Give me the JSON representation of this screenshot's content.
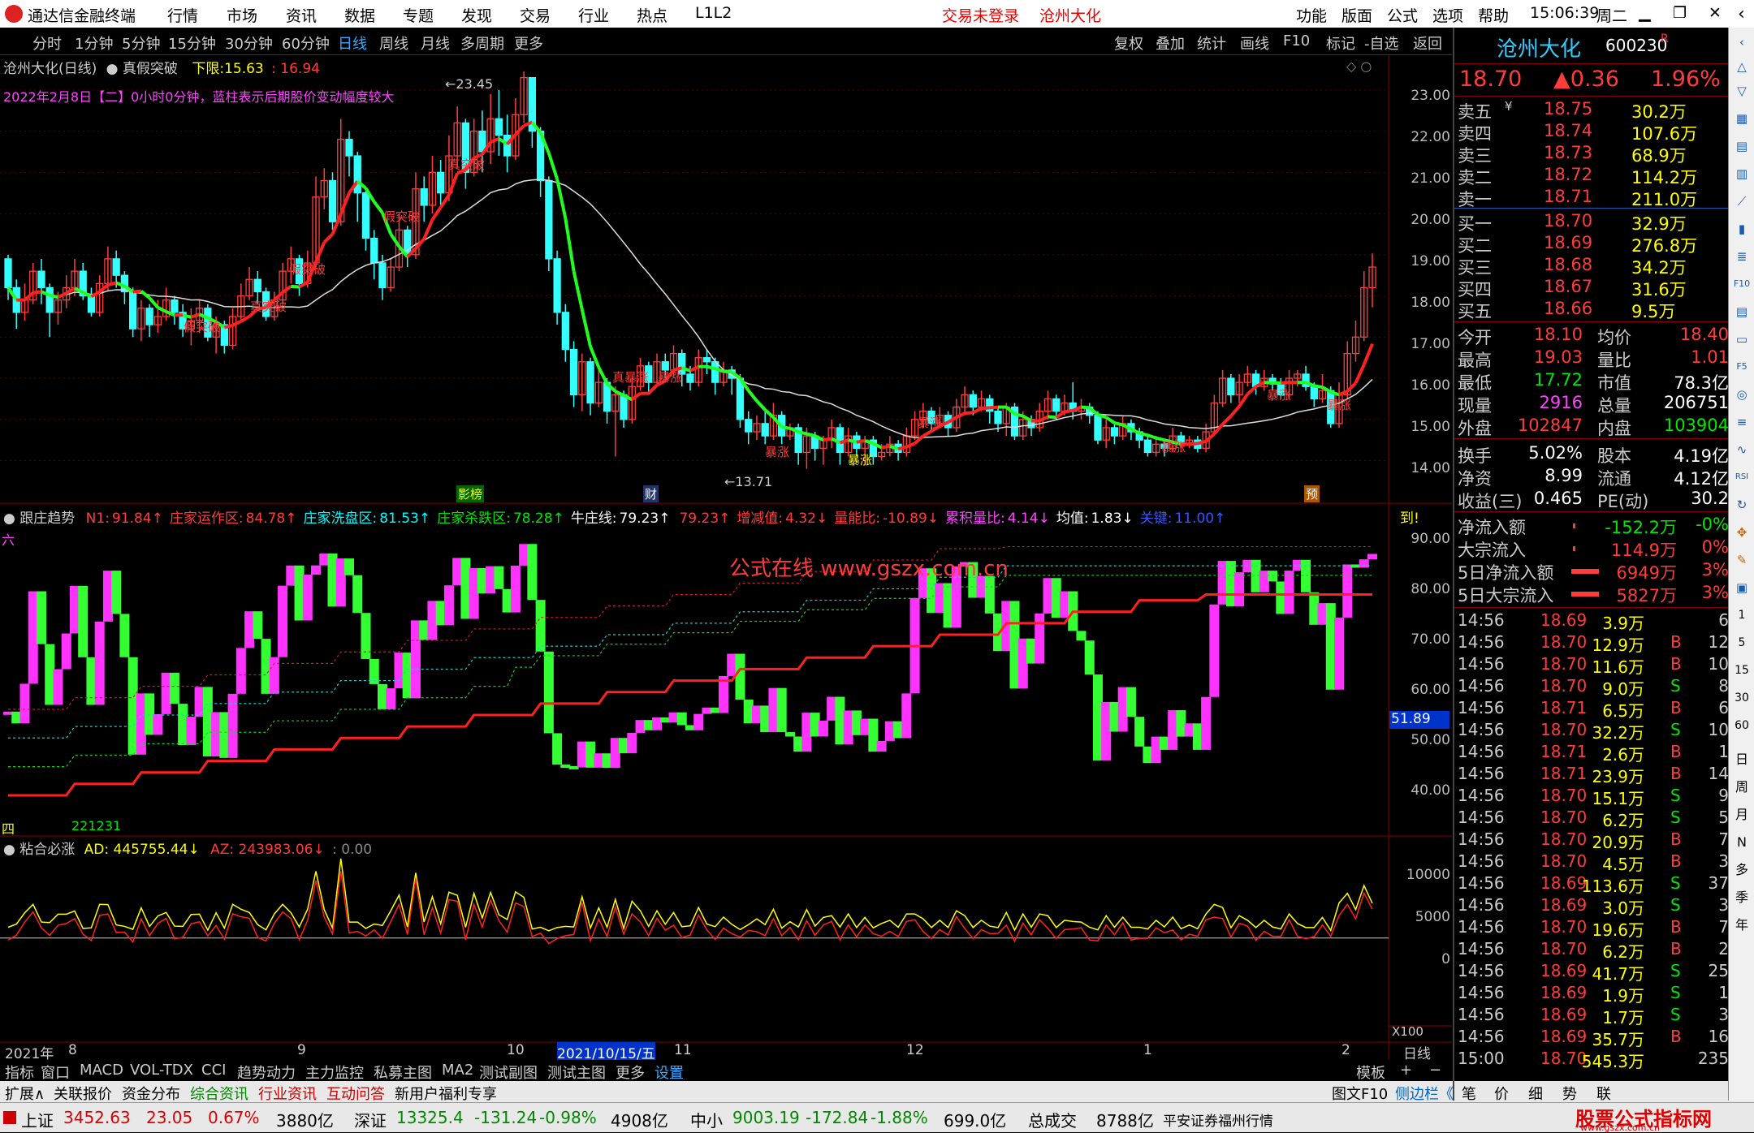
{
  "titlebar": {
    "app": "通达信金融终端",
    "menus": [
      "行情",
      "市场",
      "资讯",
      "数据",
      "专题",
      "发现",
      "交易",
      "行业",
      "热点",
      "L1L2"
    ],
    "center1": "交易未登录",
    "center2": "沧州大化",
    "rmenus": [
      "功能",
      "版面",
      "公式",
      "选项",
      "帮助"
    ],
    "time": "15:06:39",
    "weekday": "周二"
  },
  "periods": [
    "分时",
    "1分钟",
    "5分钟",
    "15分钟",
    "30分钟",
    "60分钟",
    "日线",
    "周线",
    "月线",
    "多周期",
    "更多"
  ],
  "tools": [
    "复权",
    "叠加",
    "统计",
    "画线",
    "F10",
    "标记",
    "-自选",
    "返回"
  ],
  "main": {
    "title": "沧州大化(日线)",
    "formula": "真假突破",
    "lower_label": "下限:",
    "lower_val": "15.63",
    "lower_val2": "16.94",
    "info": "2022年2月8日【二】0小时0分钟，蓝柱表示后期股价变动幅度较大",
    "high_mark": "23.45",
    "low_mark": "13.71",
    "yticks": [
      "23.00",
      "22.00",
      "21.00",
      "20.00",
      "19.00",
      "18.00",
      "17.00",
      "16.00",
      "15.00",
      "14.00"
    ],
    "signals": [
      "假突破",
      "真突破",
      "真暴涨",
      "暴涨"
    ],
    "markers": [
      "影榜",
      "财",
      "预"
    ]
  },
  "ind1": {
    "name": "跟庄趋势",
    "items": [
      {
        "k": "N1:",
        "v": "91.84↑",
        "c": "#ff3c3c"
      },
      {
        "k": "庄家运作区:",
        "v": "84.78↑",
        "c": "#ff3c3c"
      },
      {
        "k": "庄家洗盘区:",
        "v": "81.53↑",
        "c": "#00ffff"
      },
      {
        "k": "庄家杀跌区:",
        "v": "78.28↑",
        "c": "#00e600"
      },
      {
        "k": "牛庄线:",
        "v": "79.23↑",
        "c": "#ffffff"
      },
      {
        "k": "",
        "v": "79.23↑",
        "c": "#ff3c3c"
      },
      {
        "k": "增减值:",
        "v": "4.32↓",
        "c": "#ff3c3c"
      },
      {
        "k": "量能比:",
        "v": "-10.89↓",
        "c": "#ff3c3c"
      },
      {
        "k": "累积量比:",
        "v": "4.14↓",
        "c": "#ff44ff"
      },
      {
        "k": "均值:",
        "v": "1.83↓",
        "c": "#ffffff"
      },
      {
        "k": "关键:",
        "v": "11.00↑",
        "c": "#3355ff"
      }
    ],
    "tag_tr": "到!",
    "tag_liu": "六",
    "tag_si": "四",
    "bottom_val": "221231",
    "watermark": "公式在线 www.gszx.com.cn",
    "yticks": [
      "90.00",
      "80.00",
      "70.00",
      "60.00",
      "50.00",
      "40.00"
    ],
    "badge": "51.89"
  },
  "ind2": {
    "name": "粘合必涨",
    "ad_label": "AD:",
    "ad_val": "445755.44↓",
    "az_label": "AZ:",
    "az_val": "243983.06↓",
    "extra": ": 0.00",
    "yticks": [
      "10000",
      "5000",
      "0"
    ],
    "x100": "X100"
  },
  "xaxis": {
    "labels": [
      "2021年",
      "8",
      "9",
      "10",
      "2021/10/15/五",
      "11",
      "12",
      "1",
      "2"
    ],
    "right": "日线"
  },
  "tabs": [
    "指标",
    "窗口",
    "MACD",
    "VOL-TDX",
    "CCI",
    "趋势动力",
    "主力监控",
    "私募主图",
    "MA2",
    "测试副图",
    "测试主图",
    "更多",
    "设置"
  ],
  "tabs_right": [
    "模板",
    "+",
    "−"
  ],
  "bottom": [
    "扩展∧",
    "关联报价",
    "资金分布",
    "综合资讯",
    "行业资讯",
    "互动问答",
    "新用户福利专享"
  ],
  "bottom_right": [
    "图文F10",
    "侧边栏《",
    "笔",
    "价",
    "细",
    "势",
    "联"
  ],
  "status": {
    "sh": "上证",
    "sh_p": "3452.63",
    "sh_c": "23.05",
    "sh_pct": "0.67%",
    "sh_amt": "3880亿",
    "sz": "深证",
    "sz_p": "13325.4",
    "sz_c": "-131.24",
    "sz_pct": "-0.98%",
    "sz_amt": "4908亿",
    "zx": "中小",
    "zx_p": "9003.19",
    "zx_c": "-172.84",
    "zx_pct": "-1.88%",
    "zx_amt": "699.0亿",
    "total_l": "总成交",
    "total": "8788亿",
    "broker": "平安证券福州行情",
    "wm": "股票公式指标网",
    "wm2": "www.gszx.com.cn"
  },
  "quote": {
    "name": "沧州大化",
    "code": "600230",
    "r": "R",
    "price": "18.70",
    "chg": "▲0.36",
    "pct": "1.96%",
    "asks": [
      [
        "卖五",
        "¥",
        "18.75",
        "30.2万"
      ],
      [
        "卖四",
        "",
        "18.74",
        "107.6万"
      ],
      [
        "卖三",
        "",
        "18.73",
        "68.9万"
      ],
      [
        "卖二",
        "",
        "18.72",
        "114.2万"
      ],
      [
        "卖一",
        "",
        "18.71",
        "211.0万"
      ]
    ],
    "bids": [
      [
        "买一",
        "18.70",
        "32.9万"
      ],
      [
        "买二",
        "18.69",
        "276.8万"
      ],
      [
        "买三",
        "18.68",
        "34.2万"
      ],
      [
        "买四",
        "18.67",
        "31.6万"
      ],
      [
        "买五",
        "18.66",
        "9.5万"
      ]
    ],
    "stats": [
      [
        "今开",
        "18.10",
        "均价",
        "18.40"
      ],
      [
        "最高",
        "19.03",
        "量比",
        "1.01"
      ],
      [
        "最低",
        "17.72",
        "市值",
        "78.3亿"
      ],
      [
        "现量",
        "2916",
        "总量",
        "206751"
      ],
      [
        "外盘",
        "102847",
        "内盘",
        "103904"
      ],
      [
        "换手",
        "5.02%",
        "股本",
        "4.19亿"
      ],
      [
        "净资",
        "8.99",
        "流通",
        "4.12亿"
      ],
      [
        "收益(三)",
        "0.465",
        "PE(动)",
        "30.2"
      ]
    ],
    "flows": [
      [
        "净流入额",
        "-152.2万",
        "-0%"
      ],
      [
        "大宗流入",
        "114.9万",
        "0%"
      ],
      [
        "5日净流入额",
        "6949万",
        "3%"
      ],
      [
        "5日大宗流入",
        "5827万",
        "3%"
      ]
    ],
    "ticks": [
      [
        "14:56",
        "18.69",
        "3.9万",
        "",
        "6"
      ],
      [
        "14:56",
        "18.70",
        "12.9万",
        "B",
        "12"
      ],
      [
        "14:56",
        "18.70",
        "11.6万",
        "B",
        "10"
      ],
      [
        "14:56",
        "18.70",
        "9.0万",
        "S",
        "8"
      ],
      [
        "14:56",
        "18.71",
        "6.5万",
        "B",
        "6"
      ],
      [
        "14:56",
        "18.70",
        "32.2万",
        "S",
        "10"
      ],
      [
        "14:56",
        "18.71",
        "2.6万",
        "B",
        "1"
      ],
      [
        "14:56",
        "18.71",
        "23.9万",
        "B",
        "14"
      ],
      [
        "14:56",
        "18.70",
        "15.1万",
        "S",
        "9"
      ],
      [
        "14:56",
        "18.70",
        "6.2万",
        "S",
        "5"
      ],
      [
        "14:56",
        "18.70",
        "20.9万",
        "B",
        "7"
      ],
      [
        "14:56",
        "18.70",
        "4.5万",
        "B",
        "3"
      ],
      [
        "14:56",
        "18.69",
        "113.6万",
        "S",
        "37"
      ],
      [
        "14:56",
        "18.69",
        "3.0万",
        "S",
        "3"
      ],
      [
        "14:56",
        "18.70",
        "19.6万",
        "B",
        "7"
      ],
      [
        "14:56",
        "18.70",
        "6.2万",
        "B",
        "2"
      ],
      [
        "14:56",
        "18.69",
        "41.7万",
        "S",
        "25"
      ],
      [
        "14:56",
        "18.69",
        "1.9万",
        "S",
        "1"
      ],
      [
        "14:56",
        "18.69",
        "1.7万",
        "S",
        "3"
      ],
      [
        "14:56",
        "18.69",
        "35.7万",
        "B",
        "16"
      ],
      [
        "15:00",
        "18.70",
        "545.3万",
        "",
        "235"
      ]
    ]
  },
  "sidetools": [
    "日",
    "周",
    "月",
    "N",
    "多",
    "季",
    "年"
  ],
  "candles": [
    [
      18.9,
      18.2,
      19.0,
      17.9
    ],
    [
      18.2,
      17.6,
      18.4,
      17.2
    ],
    [
      17.6,
      17.9,
      18.3,
      17.4
    ],
    [
      17.9,
      18.6,
      18.8,
      17.8
    ],
    [
      18.6,
      18.2,
      18.9,
      17.8
    ],
    [
      18.2,
      17.6,
      18.3,
      17.0
    ],
    [
      17.6,
      17.9,
      18.1,
      17.3
    ],
    [
      17.9,
      18.2,
      18.5,
      17.7
    ],
    [
      18.2,
      18.6,
      18.9,
      18.0
    ],
    [
      18.6,
      18.0,
      18.8,
      17.9
    ],
    [
      18.0,
      17.6,
      18.2,
      17.5
    ],
    [
      17.6,
      18.3,
      18.5,
      17.5
    ],
    [
      18.3,
      18.9,
      19.2,
      18.1
    ],
    [
      18.9,
      18.5,
      19.1,
      18.2
    ],
    [
      18.5,
      18.1,
      18.6,
      17.8
    ],
    [
      18.1,
      17.2,
      18.2,
      17.0
    ],
    [
      17.2,
      17.7,
      17.9,
      16.9
    ],
    [
      17.7,
      17.3,
      17.8,
      17.0
    ],
    [
      17.3,
      17.5,
      17.9,
      17.1
    ],
    [
      17.5,
      17.9,
      18.2,
      17.4
    ],
    [
      17.9,
      17.6,
      18.0,
      17.3
    ],
    [
      17.6,
      17.2,
      17.8,
      17.0
    ],
    [
      17.2,
      17.4,
      17.7,
      16.8
    ],
    [
      17.4,
      17.7,
      17.9,
      17.1
    ],
    [
      17.7,
      17.0,
      17.8,
      16.9
    ],
    [
      17.0,
      17.3,
      17.5,
      16.6
    ],
    [
      17.3,
      16.8,
      17.4,
      16.6
    ],
    [
      16.8,
      17.5,
      17.7,
      16.7
    ],
    [
      17.5,
      18.0,
      18.3,
      17.4
    ],
    [
      18.0,
      18.4,
      18.7,
      17.9
    ],
    [
      18.4,
      18.1,
      18.6,
      17.8
    ],
    [
      18.1,
      17.5,
      18.2,
      17.4
    ],
    [
      17.5,
      17.9,
      18.1,
      17.4
    ],
    [
      17.9,
      18.6,
      18.8,
      17.8
    ],
    [
      18.6,
      18.9,
      19.2,
      18.3
    ],
    [
      18.9,
      18.3,
      19.0,
      18.0
    ],
    [
      18.3,
      18.8,
      19.1,
      18.2
    ],
    [
      18.8,
      20.4,
      20.9,
      18.7
    ],
    [
      20.4,
      20.8,
      21.1,
      20.1
    ],
    [
      20.8,
      19.8,
      21.0,
      19.6
    ],
    [
      19.8,
      21.8,
      22.3,
      19.7
    ],
    [
      21.8,
      21.4,
      22.0,
      20.9
    ],
    [
      21.4,
      20.5,
      21.5,
      19.8
    ],
    [
      20.5,
      19.4,
      20.6,
      19.1
    ],
    [
      19.4,
      18.8,
      19.6,
      18.4
    ],
    [
      18.8,
      18.2,
      19.0,
      17.9
    ],
    [
      18.2,
      18.7,
      18.9,
      18.1
    ],
    [
      18.7,
      19.6,
      20.0,
      18.6
    ],
    [
      19.6,
      19.0,
      19.7,
      18.7
    ],
    [
      19.0,
      20.6,
      21.0,
      18.9
    ],
    [
      20.6,
      20.2,
      20.9,
      19.8
    ],
    [
      20.2,
      21.0,
      21.4,
      20.0
    ],
    [
      21.0,
      20.5,
      21.3,
      20.2
    ],
    [
      20.5,
      21.4,
      21.9,
      20.3
    ],
    [
      21.4,
      22.2,
      22.6,
      21.1
    ],
    [
      22.2,
      21.0,
      22.3,
      20.6
    ],
    [
      21.0,
      22.0,
      22.3,
      20.9
    ],
    [
      22.0,
      21.5,
      22.5,
      21.0
    ],
    [
      21.5,
      22.3,
      22.9,
      21.2
    ],
    [
      22.3,
      21.9,
      23.0,
      21.4
    ],
    [
      21.9,
      21.4,
      22.4,
      21.0
    ],
    [
      21.4,
      22.4,
      22.8,
      21.3
    ],
    [
      22.4,
      23.3,
      23.45,
      22.2
    ],
    [
      23.3,
      22.0,
      23.3,
      21.6
    ],
    [
      22.0,
      20.8,
      22.1,
      20.4
    ],
    [
      20.8,
      18.9,
      20.9,
      18.6
    ],
    [
      18.9,
      17.6,
      19.1,
      17.3
    ],
    [
      17.6,
      16.7,
      17.8,
      16.4
    ],
    [
      16.7,
      15.6,
      16.9,
      15.3
    ],
    [
      15.6,
      16.4,
      16.6,
      15.2
    ],
    [
      16.4,
      15.4,
      16.5,
      15.1
    ],
    [
      15.4,
      15.9,
      16.3,
      15.3
    ],
    [
      15.9,
      15.2,
      16.0,
      14.9
    ],
    [
      15.2,
      15.6,
      15.8,
      14.1
    ],
    [
      15.6,
      15.0,
      15.7,
      14.8
    ],
    [
      15.0,
      15.8,
      16.0,
      14.9
    ],
    [
      15.8,
      16.3,
      16.5,
      15.7
    ],
    [
      16.3,
      15.9,
      16.4,
      15.6
    ],
    [
      15.9,
      16.4,
      16.6,
      15.8
    ],
    [
      16.4,
      16.2,
      16.6,
      15.9
    ],
    [
      16.2,
      16.6,
      16.8,
      16.0
    ],
    [
      16.6,
      16.1,
      16.7,
      15.8
    ],
    [
      16.1,
      15.9,
      16.3,
      15.7
    ],
    [
      15.9,
      16.5,
      16.7,
      15.8
    ],
    [
      16.5,
      16.4,
      16.7,
      16.1
    ],
    [
      16.4,
      15.9,
      16.5,
      15.6
    ],
    [
      15.9,
      16.2,
      16.4,
      15.8
    ],
    [
      16.2,
      16.0,
      16.3,
      15.6
    ],
    [
      16.0,
      15.0,
      16.1,
      14.8
    ],
    [
      15.0,
      14.7,
      15.2,
      14.4
    ],
    [
      14.7,
      14.9,
      15.1,
      14.5
    ],
    [
      14.9,
      14.6,
      15.2,
      14.4
    ],
    [
      14.6,
      15.1,
      15.4,
      14.5
    ],
    [
      15.1,
      14.6,
      15.2,
      14.4
    ],
    [
      14.6,
      14.8,
      14.9,
      14.5
    ],
    [
      14.8,
      14.2,
      14.9,
      13.9
    ],
    [
      14.2,
      14.6,
      14.8,
      13.8
    ],
    [
      14.6,
      14.3,
      14.7,
      14.0
    ],
    [
      14.3,
      14.5,
      14.6,
      13.9
    ],
    [
      14.5,
      14.8,
      15.0,
      14.3
    ],
    [
      14.8,
      14.2,
      14.9,
      13.9
    ],
    [
      14.2,
      14.6,
      14.8,
      14.1
    ],
    [
      14.6,
      14.3,
      14.7,
      14.1
    ],
    [
      14.3,
      14.5,
      14.6,
      13.9
    ],
    [
      14.5,
      14.1,
      14.6,
      13.9
    ],
    [
      14.1,
      14.2,
      14.4,
      14.0
    ],
    [
      14.2,
      14.4,
      14.6,
      14.1
    ],
    [
      14.4,
      14.2,
      14.5,
      14.0
    ],
    [
      14.2,
      14.6,
      14.8,
      14.1
    ],
    [
      14.6,
      15.0,
      15.2,
      14.5
    ],
    [
      15.0,
      15.2,
      15.4,
      14.8
    ],
    [
      15.2,
      14.9,
      15.3,
      14.7
    ],
    [
      14.9,
      15.1,
      15.3,
      14.8
    ],
    [
      15.1,
      14.8,
      15.2,
      14.6
    ],
    [
      14.8,
      15.3,
      15.5,
      14.7
    ],
    [
      15.3,
      15.6,
      15.8,
      15.1
    ],
    [
      15.6,
      15.3,
      15.7,
      15.1
    ],
    [
      15.3,
      15.5,
      15.7,
      15.2
    ],
    [
      15.5,
      15.2,
      15.6,
      14.9
    ],
    [
      15.2,
      14.9,
      15.3,
      14.7
    ],
    [
      14.9,
      15.3,
      15.4,
      14.6
    ],
    [
      15.3,
      14.6,
      15.4,
      14.5
    ],
    [
      14.6,
      15.0,
      15.2,
      14.5
    ],
    [
      15.0,
      14.8,
      15.1,
      14.6
    ],
    [
      14.8,
      15.2,
      15.4,
      14.7
    ],
    [
      15.2,
      15.5,
      15.7,
      15.0
    ],
    [
      15.5,
      15.2,
      15.6,
      15.0
    ],
    [
      15.2,
      15.4,
      15.6,
      15.1
    ],
    [
      15.4,
      15.2,
      15.9,
      15.0
    ],
    [
      15.2,
      15.3,
      15.5,
      15.0
    ],
    [
      15.3,
      15.1,
      15.4,
      14.9
    ],
    [
      15.1,
      14.5,
      15.2,
      14.4
    ],
    [
      14.5,
      14.8,
      15.0,
      14.3
    ],
    [
      14.8,
      14.6,
      14.9,
      14.4
    ],
    [
      14.6,
      14.9,
      15.1,
      14.5
    ],
    [
      14.9,
      14.7,
      15.0,
      14.5
    ],
    [
      14.7,
      14.5,
      14.8,
      14.3
    ],
    [
      14.5,
      14.2,
      14.6,
      14.1
    ],
    [
      14.2,
      14.4,
      14.6,
      14.1
    ],
    [
      14.4,
      14.3,
      14.5,
      14.1
    ],
    [
      14.3,
      14.6,
      14.8,
      14.2
    ],
    [
      14.6,
      14.4,
      14.7,
      14.3
    ],
    [
      14.4,
      14.5,
      14.6,
      14.3
    ],
    [
      14.5,
      14.3,
      14.6,
      14.2
    ],
    [
      14.3,
      14.7,
      14.9,
      14.2
    ],
    [
      14.7,
      15.4,
      15.6,
      14.6
    ],
    [
      15.4,
      16.0,
      16.2,
      15.3
    ],
    [
      16.0,
      15.6,
      16.1,
      15.4
    ],
    [
      15.6,
      15.9,
      16.1,
      15.4
    ],
    [
      15.9,
      16.1,
      16.3,
      15.8
    ],
    [
      16.1,
      15.8,
      16.2,
      15.6
    ],
    [
      15.8,
      16.0,
      16.2,
      15.7
    ],
    [
      16.0,
      15.9,
      16.1,
      15.7
    ],
    [
      15.9,
      15.6,
      16.0,
      15.5
    ],
    [
      15.6,
      16.0,
      16.2,
      15.5
    ],
    [
      16.0,
      16.1,
      16.2,
      15.8
    ],
    [
      16.1,
      15.8,
      16.3,
      15.7
    ],
    [
      15.8,
      15.5,
      15.9,
      15.3
    ],
    [
      15.5,
      15.7,
      16.1,
      15.4
    ],
    [
      15.7,
      14.9,
      15.8,
      14.8
    ],
    [
      14.9,
      15.6,
      15.9,
      14.8
    ],
    [
      15.6,
      16.6,
      16.9,
      15.5
    ],
    [
      16.6,
      17.0,
      17.4,
      16.4
    ],
    [
      17.0,
      18.2,
      18.6,
      16.9
    ],
    [
      18.2,
      18.7,
      19.03,
      17.72
    ]
  ]
}
